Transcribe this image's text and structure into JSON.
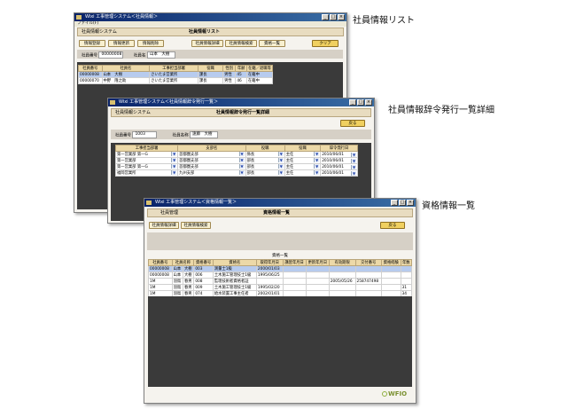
{
  "captions": {
    "list": "社員情報リスト",
    "detail": "社員情報辞令発行一覧詳細",
    "qual": "資格情報一覧"
  },
  "w1": {
    "title": "Wixi 工事管理システム＜社員情報＞",
    "menu": "ファイル(F)",
    "system": "社員情報システム",
    "header": "社員情報リスト",
    "btn_add": "情報登録",
    "btn_edit": "情報更新",
    "btn_del": "情報削除",
    "btn_detail": "社員情報詳細",
    "btn_search": "社員情報検索",
    "btn_list": "資格一覧",
    "btn_clear": "クリア",
    "emp_no_label": "社員番号",
    "emp_no": "00000008",
    "emp_name_label": "社員名",
    "emp_name": "山本　大樹",
    "columns": [
      "社員番号",
      "社員名",
      "工事担当部署",
      "役職",
      "性別",
      "年齢",
      "在籍／退職等"
    ],
    "rows": [
      [
        "00000008",
        "山本　大樹",
        "さいたま営業所",
        "課長",
        "男性",
        "45",
        "在籍中"
      ],
      [
        "00000070",
        "中野　隆之助",
        "さいたま営業所",
        "課長",
        "男性",
        "46",
        "在籍中"
      ]
    ]
  },
  "w2": {
    "title": "Wixi 工事管理システム＜社員情報辞令発行一覧＞",
    "system": "社員情報システム",
    "header": "社員情報辞令発行一覧詳細",
    "btn_back": "戻る",
    "emp_no_label": "社員番号",
    "emp_no": "1003",
    "emp_name_label": "社員名称",
    "emp_name": "遠藤　大樹",
    "columns": [
      "工事担当部署",
      "支部名",
      "役職",
      "役職",
      "辞令発行日"
    ],
    "rows": [
      [
        "第一営業部 第一G",
        "首都圏支部",
        "係長",
        "主任",
        "2010/06/01"
      ],
      [
        "第一営業部",
        "首都圏支部",
        "部長",
        "主任",
        "2010/06/01"
      ],
      [
        "第一営業部 第一G",
        "首都圏支部",
        "部長",
        "主任",
        "2010/06/01"
      ],
      [
        "福岡営業所",
        "九州支部",
        "部長",
        "主任",
        "2010/06/01"
      ]
    ]
  },
  "w3": {
    "title": "Wixi 工事管理システム＜資格情報一覧＞",
    "system": "社員管理",
    "header": "資格情報一覧",
    "btn_detail": "社員情報詳細",
    "btn_search": "社員情報検索",
    "btn_back": "戻る",
    "grid_title": "資格一覧",
    "columns": [
      "社員番号",
      "社員名称",
      "資格番号",
      "資格名",
      "取得年月日",
      "講習年月日",
      "更新年月日",
      "有効期限",
      "交付番号",
      "交付番号",
      "資格経験",
      "年数"
    ],
    "rows": [
      [
        "00000008",
        "山本",
        "大樹",
        "003",
        "測量士1級",
        "2000/01/03",
        "",
        "",
        "",
        "",
        "",
        ""
      ],
      [
        "00000008",
        "山本",
        "大樹",
        "006",
        "土木施工管理技士1級",
        "1995/06/25",
        "",
        "",
        "",
        "",
        "",
        ""
      ],
      [
        "1M",
        "羽鳥",
        "春男",
        "008",
        "監理技術者資格者証",
        "",
        "",
        "",
        "2005/05/26",
        "258747498",
        "",
        ""
      ],
      [
        "1M",
        "羽鳥",
        "春男",
        "009",
        "土木施工管理技士1級",
        "1995/02/20",
        "",
        "",
        "",
        "",
        "",
        "31"
      ],
      [
        "1M",
        "羽鳥",
        "春男",
        "074",
        "給水装置工事主任者",
        "2002/01/01",
        "",
        "",
        "",
        "",
        "",
        "34"
      ]
    ],
    "logo": "WFIO"
  }
}
